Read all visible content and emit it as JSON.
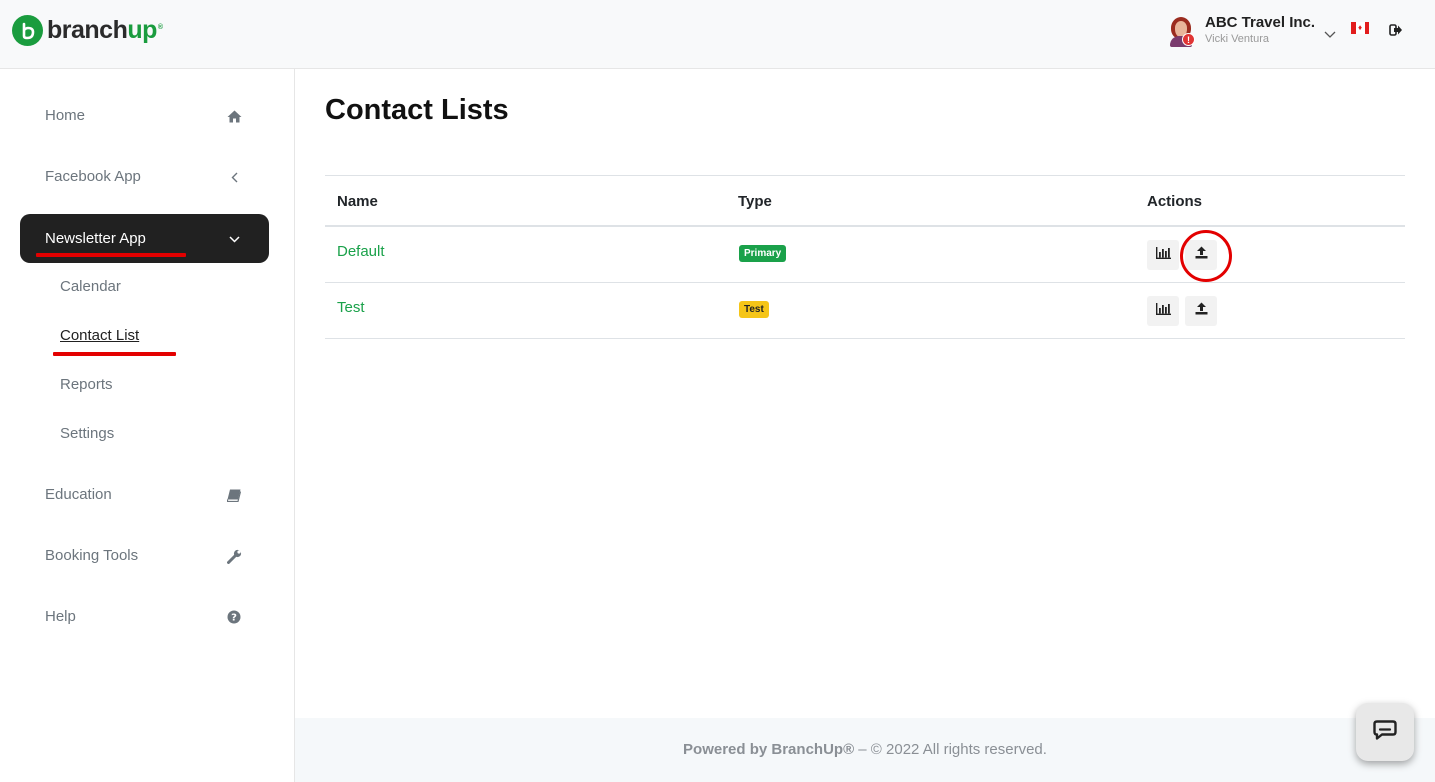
{
  "brand": {
    "name_main": "branch",
    "name_accent": "up",
    "trademark": "®"
  },
  "account": {
    "company": "ABC Travel Inc.",
    "user": "Vicki Ventura",
    "alert_count": "!"
  },
  "sidebar": {
    "items": [
      {
        "label": "Home",
        "icon": "home-icon"
      },
      {
        "label": "Facebook App",
        "icon": "chevron-left-icon"
      },
      {
        "label": "Newsletter App",
        "icon": "chevron-down-icon"
      },
      {
        "label": "Education",
        "icon": "book-icon"
      },
      {
        "label": "Booking Tools",
        "icon": "wrench-icon"
      },
      {
        "label": "Help",
        "icon": "question-circle-icon"
      }
    ],
    "newsletter_sub": [
      "Calendar",
      "Contact List",
      "Reports",
      "Settings"
    ]
  },
  "page": {
    "title": "Contact Lists"
  },
  "table": {
    "headers": [
      "Name",
      "Type",
      "Actions"
    ],
    "rows": [
      {
        "name": "Default",
        "type": "Primary"
      },
      {
        "name": "Test",
        "type": "Test"
      }
    ]
  },
  "footer": {
    "brand": "Powered by BranchUp®",
    "rest": " – © 2022 All rights reserved."
  },
  "colors": {
    "accent": "#1aa14a",
    "active_nav": "#212121",
    "highlight": "#e30000",
    "badge_test": "#f5c518"
  }
}
